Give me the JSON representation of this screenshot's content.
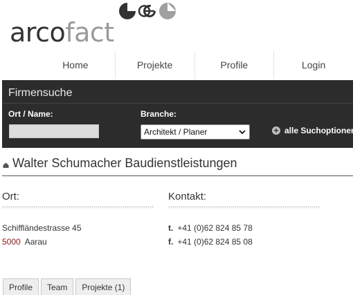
{
  "logo": {
    "part_a": "arco",
    "part_b": "fact"
  },
  "nav": {
    "items": [
      "Home",
      "Projekte",
      "Profile",
      "Login"
    ]
  },
  "search": {
    "title": "Firmensuche",
    "name_label": "Ort / Name:",
    "name_value": "",
    "branch_label": "Branche:",
    "branch_selected": "Architekt / Planer",
    "all_options": "alle Suchoptionen"
  },
  "company": {
    "name": "Walter Schumacher Baudienstleistungen"
  },
  "location": {
    "title": "Ort:",
    "street": "Schiffländestrasse 45",
    "zip": "5000",
    "city": "Aarau"
  },
  "contact": {
    "title": "Kontakt:",
    "phone_prefix": "t.",
    "phone": "+41 (0)62 824 85 78",
    "fax_prefix": "f.",
    "fax": "+41 (0)62 824 85 08"
  },
  "tabs": [
    "Profile",
    "Team",
    "Projekte (1)"
  ],
  "colors": {
    "header_bg": "#2c2c2c",
    "zip": "#8b1a1a",
    "logo_dark": "#333333",
    "logo_light": "#9a9a9a"
  }
}
